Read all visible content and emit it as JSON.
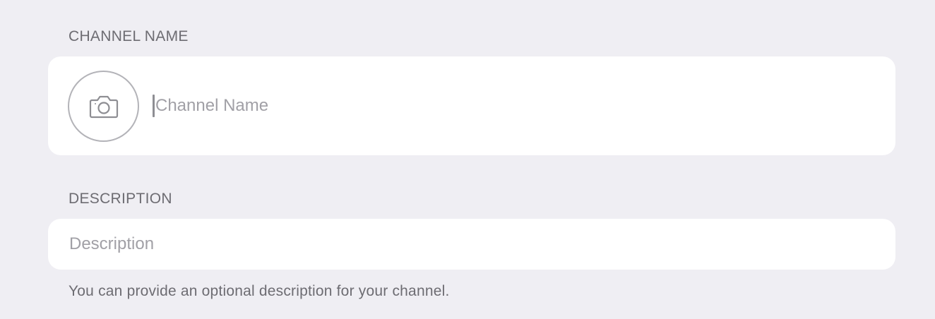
{
  "form": {
    "channel_name_header": "CHANNEL NAME",
    "channel_name": {
      "value": "",
      "placeholder": "Channel Name"
    },
    "description_header": "DESCRIPTION",
    "description": {
      "value": "",
      "placeholder": "Description"
    },
    "description_footer": "You can provide an optional description for your channel."
  },
  "icons": {
    "avatar": "camera-icon"
  },
  "colors": {
    "background": "#efeef3",
    "card": "#ffffff",
    "header_text": "#6d6c72",
    "placeholder_text": "#a1a0a6",
    "icon_stroke": "#8e8e93"
  }
}
